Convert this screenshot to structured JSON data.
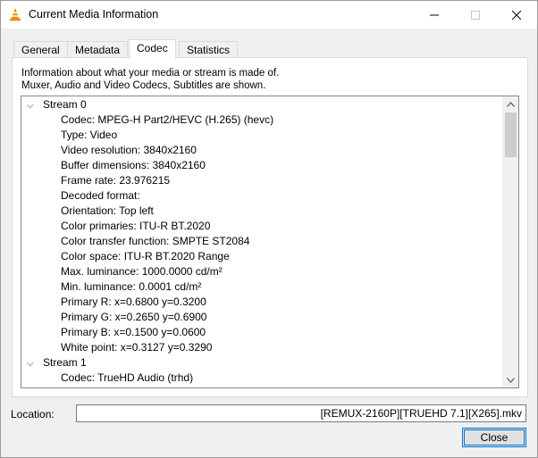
{
  "window": {
    "title": "Current Media Information",
    "icon": "vlc-cone-icon"
  },
  "tabs": [
    {
      "label": "General",
      "active": false
    },
    {
      "label": "Metadata",
      "active": false
    },
    {
      "label": "Codec",
      "active": true
    },
    {
      "label": "Statistics",
      "active": false
    }
  ],
  "codec": {
    "intro_line1": "Information about what your media or stream is made of.",
    "intro_line2": "Muxer, Audio and Video Codecs, Subtitles are shown.",
    "streams": [
      {
        "name": "Stream 0",
        "expanded": true,
        "properties": [
          "Codec: MPEG-H Part2/HEVC (H.265) (hevc)",
          "Type: Video",
          "Video resolution: 3840x2160",
          "Buffer dimensions: 3840x2160",
          "Frame rate: 23.976215",
          "Decoded format:",
          "Orientation: Top left",
          "Color primaries: ITU-R BT.2020",
          "Color transfer function: SMPTE ST2084",
          "Color space: ITU-R BT.2020 Range",
          "Max. luminance: 1000.0000 cd/m²",
          "Min. luminance: 0.0001 cd/m²",
          "Primary R: x=0.6800 y=0.3200",
          "Primary G: x=0.2650 y=0.6900",
          "Primary B: x=0.1500 y=0.0600",
          "White point: x=0.3127 y=0.3290"
        ]
      },
      {
        "name": "Stream 1",
        "expanded": true,
        "properties": [
          "Codec: TrueHD Audio (trhd)"
        ]
      }
    ]
  },
  "location": {
    "label": "Location:",
    "value": "[REMUX-2160P][TRUEHD 7.1][X265].mkv"
  },
  "buttons": {
    "close_label": "Close"
  }
}
